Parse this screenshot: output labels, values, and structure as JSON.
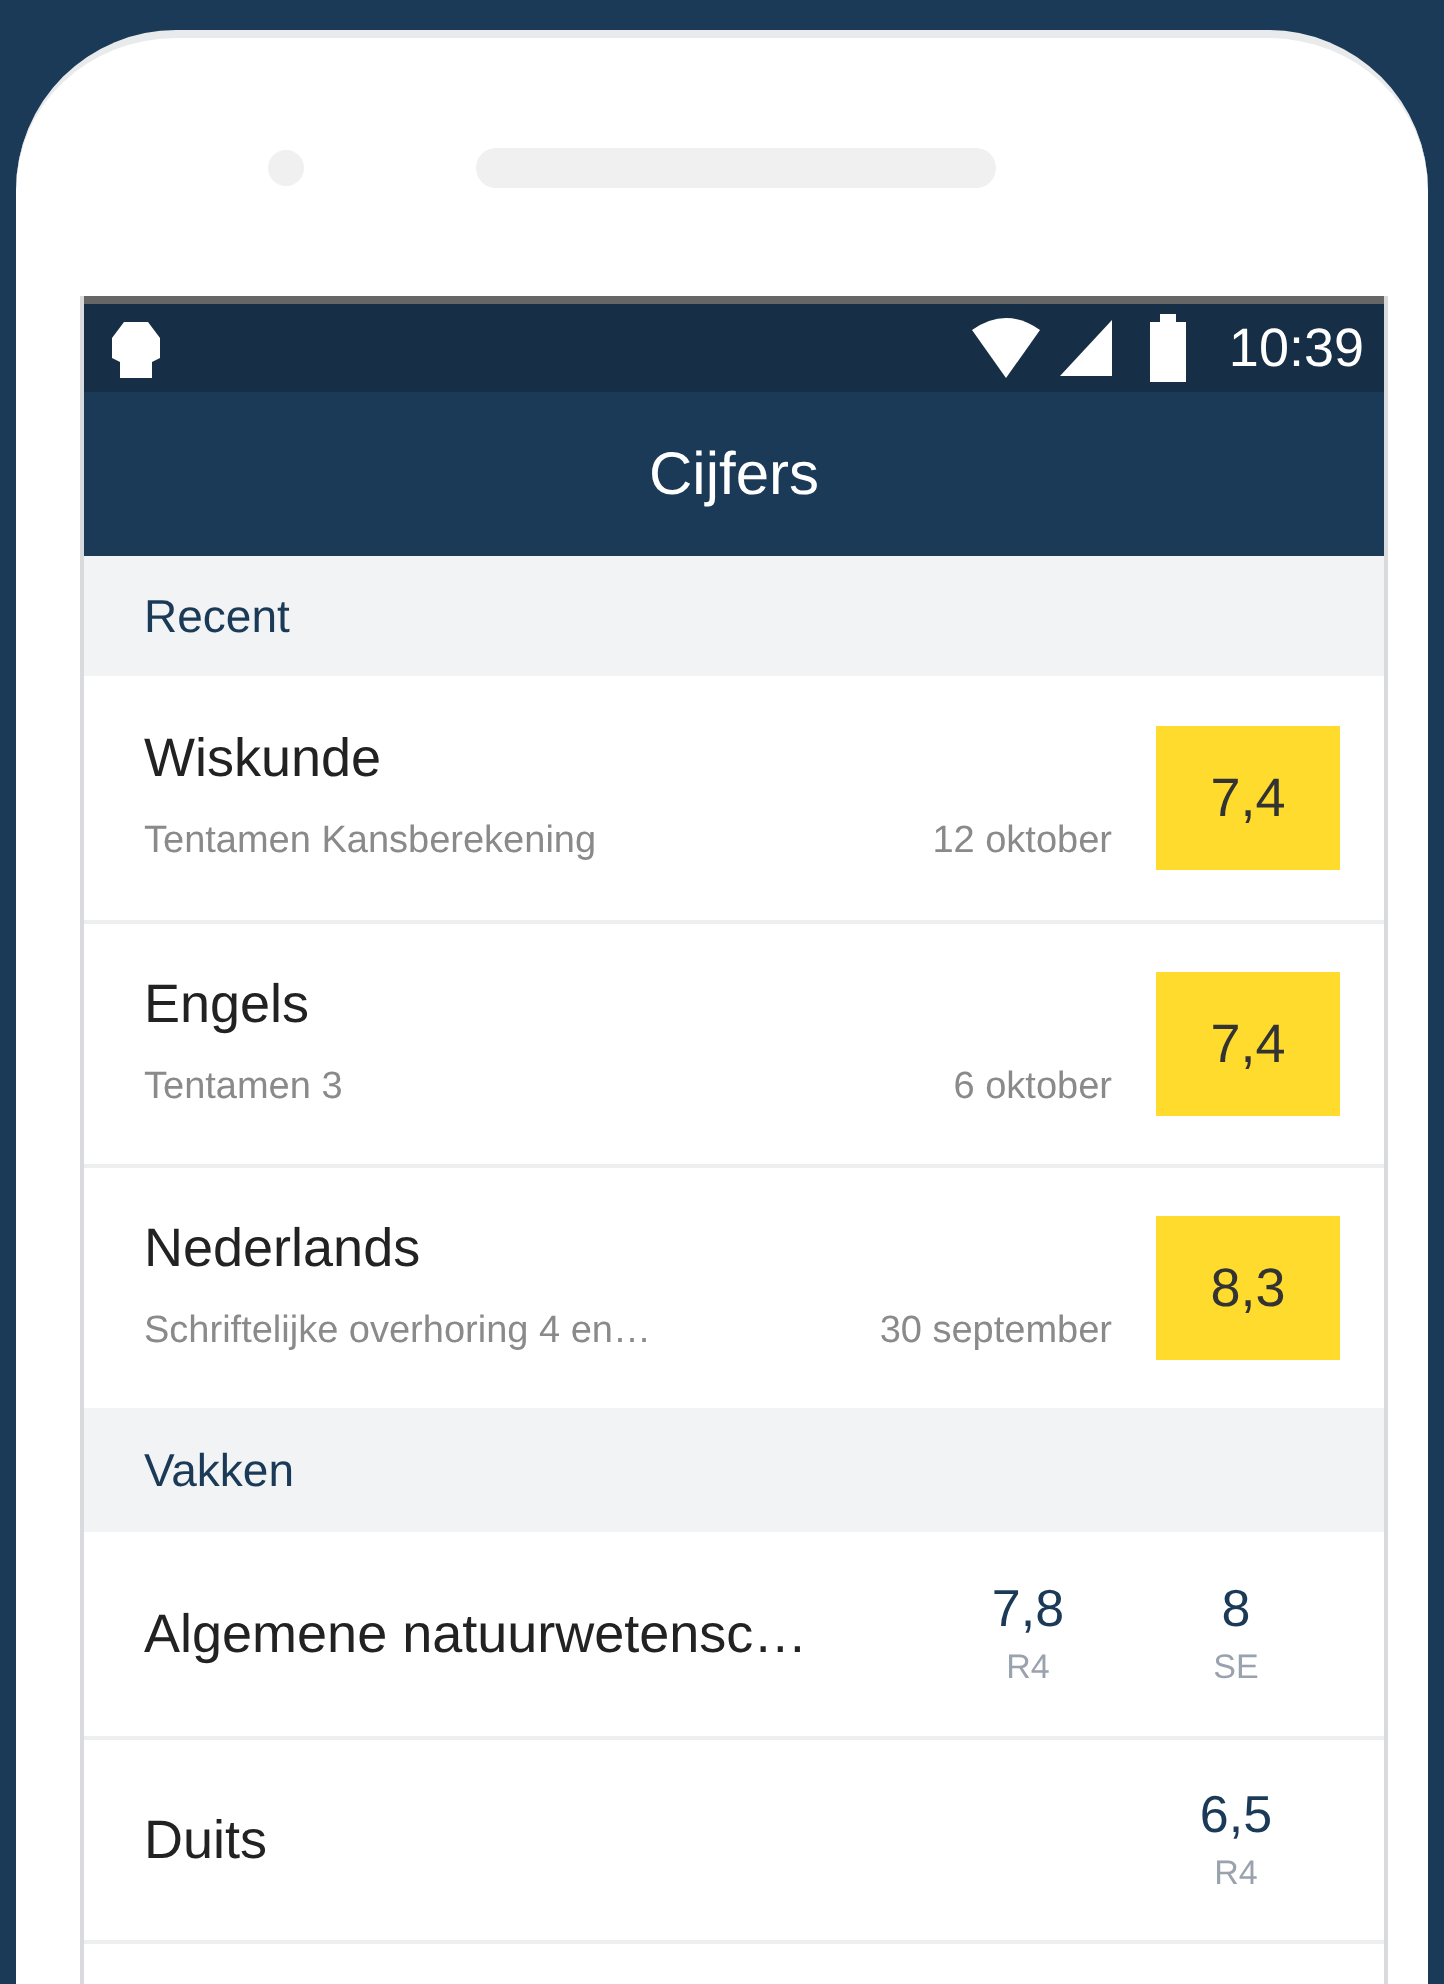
{
  "status_bar": {
    "time": "10:39"
  },
  "app_bar": {
    "title": "Cijfers"
  },
  "recent": {
    "header": "Recent",
    "items": [
      {
        "subject": "Wiskunde",
        "description": "Tentamen Kansberekening",
        "date": "12 oktober",
        "grade": "7,4"
      },
      {
        "subject": "Engels",
        "description": "Tentamen 3",
        "date": "6 oktober",
        "grade": "7,4"
      },
      {
        "subject": "Nederlands",
        "description": "Schriftelijke overhoring 4 en…",
        "date": "30 september",
        "grade": "8,3"
      }
    ]
  },
  "subjects": {
    "header": "Vakken",
    "items": [
      {
        "name": "Algemene natuurwetensc…",
        "grades": [
          {
            "value": "7,8",
            "label": "R4"
          },
          {
            "value": "8",
            "label": "SE"
          }
        ]
      },
      {
        "name": "Duits",
        "grades": [
          {
            "value": "6,5",
            "label": "R4"
          }
        ]
      }
    ]
  }
}
